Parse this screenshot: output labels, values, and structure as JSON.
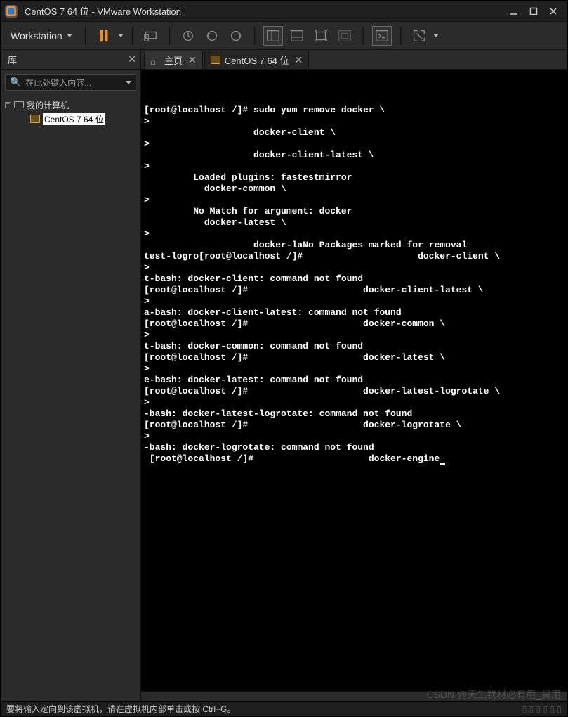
{
  "window": {
    "title": "CentOS 7 64 位 - VMware Workstation"
  },
  "menu": {
    "workstation": "Workstation"
  },
  "sidebar": {
    "title": "库",
    "search_placeholder": "在此处键入内容...",
    "root": "我的计算机",
    "vm": "CentOS 7 64 位"
  },
  "tabs": {
    "home": "主页",
    "vm": "CentOS 7 64 位"
  },
  "terminal_lines": [
    "[root@localhost /]# sudo yum remove docker \\",
    ">",
    "                    docker-client \\",
    ">",
    "                    docker-client-latest \\",
    ">",
    "         Loaded plugins: fastestmirror",
    "           docker-common \\",
    ">",
    "         No Match for argument: docker",
    "           docker-latest \\",
    ">",
    "                    docker-laNo Packages marked for removal",
    "test-logro[root@localhost /]#                     docker-client \\",
    ">",
    "t-bash: docker-client: command not found",
    "[root@localhost /]#                     docker-client-latest \\",
    ">",
    "a-bash: docker-client-latest: command not found",
    "[root@localhost /]#                     docker-common \\",
    ">",
    "t-bash: docker-common: command not found",
    "[root@localhost /]#                     docker-latest \\",
    ">",
    "e-bash: docker-latest: command not found",
    "[root@localhost /]#                     docker-latest-logrotate \\",
    ">",
    "-bash: docker-latest-logrotate: command not found",
    "[root@localhost /]#                     docker-logrotate \\",
    ">",
    "-bash: docker-logrotate: command not found",
    " [root@localhost /]#                     docker-engine"
  ],
  "statusbar": {
    "hint": "要将输入定向到该虚拟机，请在虚拟机内部单击或按 Ctrl+G。"
  },
  "watermark": "CSDN @天生我材必有用_吴用"
}
